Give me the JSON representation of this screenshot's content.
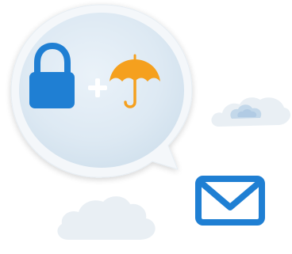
{
  "illustration": {
    "icons": {
      "lock": "lock-icon",
      "plus": "plus-icon",
      "umbrella": "umbrella-icon",
      "envelope": "envelope-icon",
      "clouds": "cloud-icon"
    },
    "colors": {
      "lock_blue": "#1f7fd3",
      "umbrella_orange": "#f5a01e",
      "envelope_blue": "#1f7fd3",
      "bubble_fill": "#e3eef7",
      "bubble_rim": "#f4f7fa",
      "cloud_light": "#e9eff4",
      "cloud_blue_accent": "#bcd3e8",
      "plus_white": "#ffffff"
    }
  }
}
